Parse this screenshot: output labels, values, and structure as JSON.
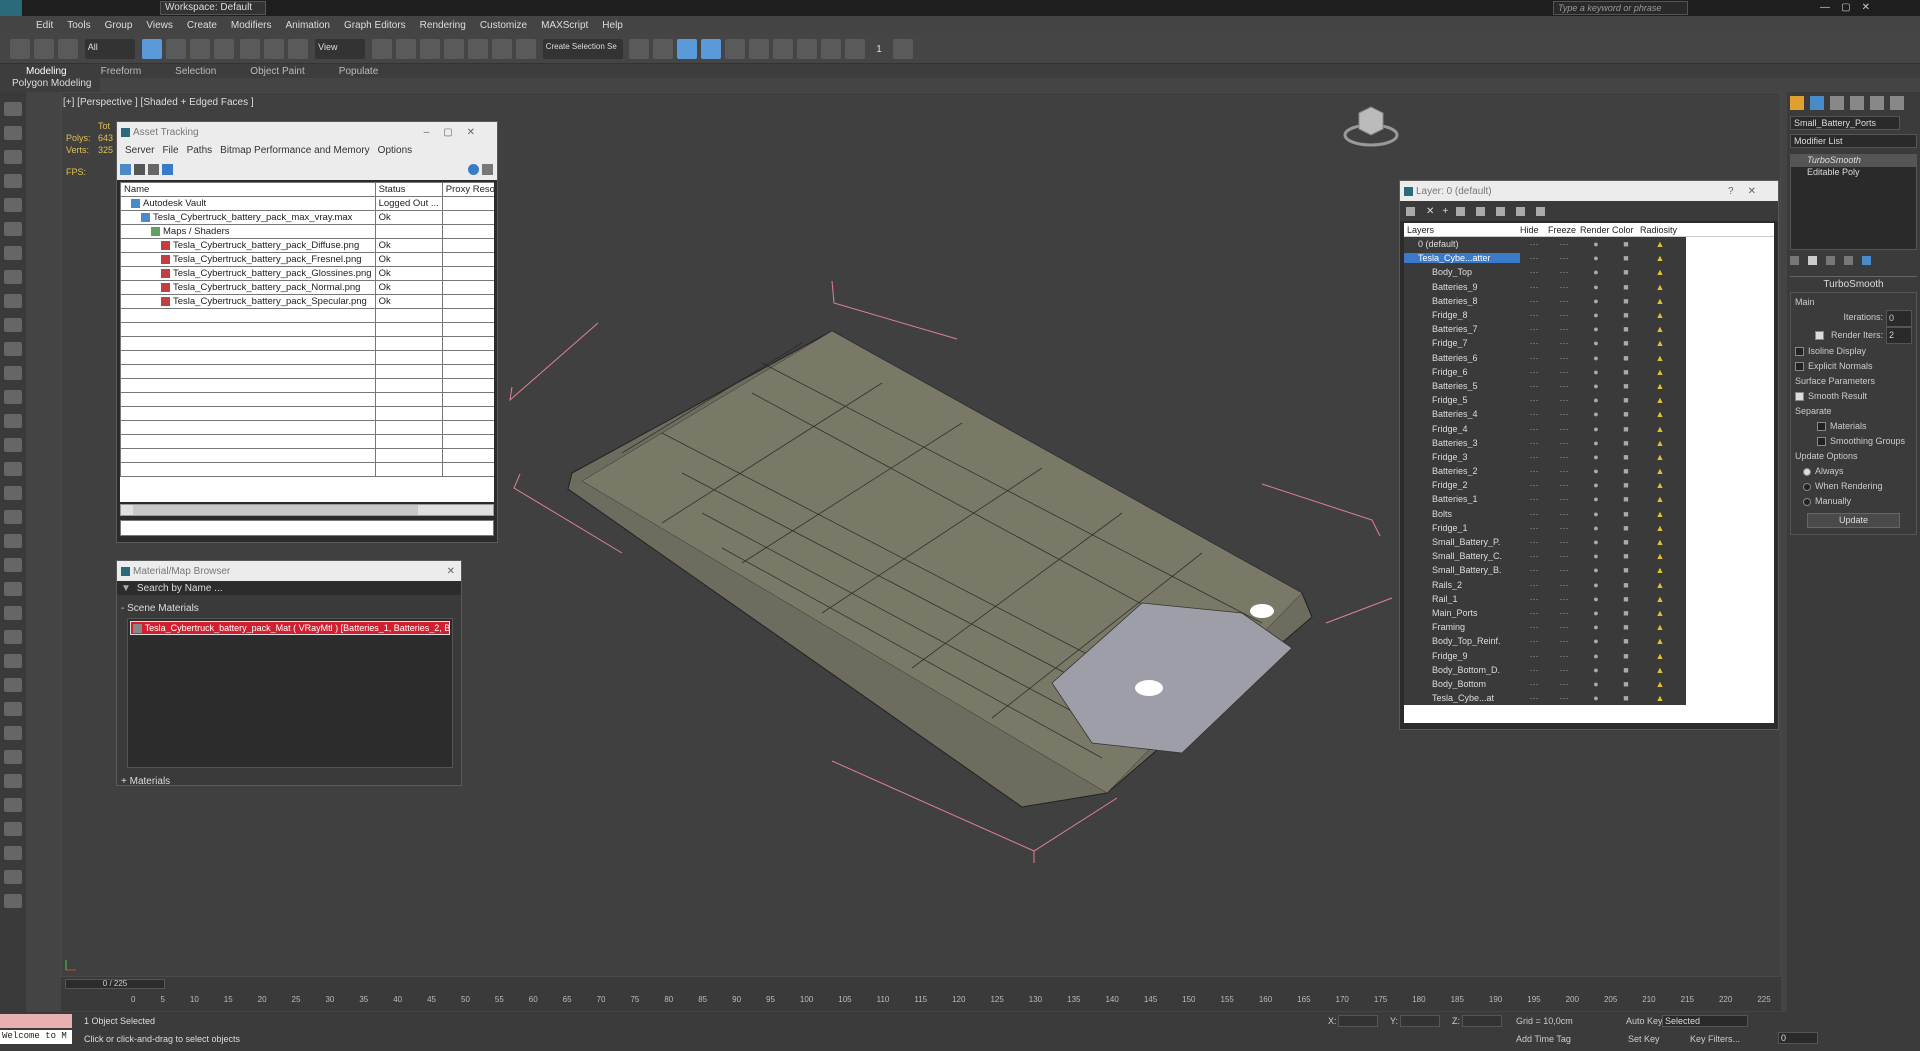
{
  "app": {
    "workspace": "Workspace: Default",
    "search_placeholder": "Type a keyword or phrase"
  },
  "menu": [
    "Edit",
    "Tools",
    "Group",
    "Views",
    "Create",
    "Modifiers",
    "Animation",
    "Graph Editors",
    "Rendering",
    "Customize",
    "MAXScript",
    "Help"
  ],
  "toolbar": {
    "filter": "All",
    "view": "View",
    "selection_set": "Create Selection Se",
    "counter": "1"
  },
  "ribbon": {
    "tabs": [
      "Modeling",
      "Freeform",
      "Selection",
      "Object Paint",
      "Populate"
    ],
    "sub": "Polygon Modeling"
  },
  "viewport": {
    "label": "[+] [Perspective ] [Shaded + Edged Faces ]",
    "stats": {
      "total": "Tot",
      "polys": "Polys:",
      "polys_val": "643",
      "verts": "Verts:",
      "verts_val": "325",
      "fps": "FPS:"
    }
  },
  "asset_tracking": {
    "title": "Asset Tracking",
    "menu": [
      "Server",
      "File",
      "Paths",
      "Bitmap Performance and Memory",
      "Options"
    ],
    "columns": [
      "Name",
      "Status",
      "Proxy Reso"
    ],
    "rows": [
      {
        "name": "Autodesk Vault",
        "status": "Logged Out ...",
        "indent": 1
      },
      {
        "name": "Tesla_Cybertruck_battery_pack_max_vray.max",
        "status": "Ok",
        "indent": 2
      },
      {
        "name": "Maps / Shaders",
        "status": "",
        "indent": 3
      },
      {
        "name": "Tesla_Cybertruck_battery_pack_Diffuse.png",
        "status": "Ok",
        "indent": 4
      },
      {
        "name": "Tesla_Cybertruck_battery_pack_Fresnel.png",
        "status": "Ok",
        "indent": 4
      },
      {
        "name": "Tesla_Cybertruck_battery_pack_Glossines.png",
        "status": "Ok",
        "indent": 4
      },
      {
        "name": "Tesla_Cybertruck_battery_pack_Normal.png",
        "status": "Ok",
        "indent": 4
      },
      {
        "name": "Tesla_Cybertruck_battery_pack_Specular.png",
        "status": "Ok",
        "indent": 4
      }
    ]
  },
  "material_browser": {
    "title": "Material/Map Browser",
    "search_placeholder": "Search by Name ...",
    "section": "- Scene Materials",
    "material": "Tesla_Cybertruck_battery_pack_Mat ( VRayMtl ) [Batteries_1, Batteries_2, Ba...",
    "footer": "+ Materials"
  },
  "layer_explorer": {
    "title": "Layer: 0 (default)",
    "columns": [
      "Layers",
      "Hide",
      "Freeze",
      "Render",
      "Color",
      "Radiosity"
    ],
    "layers": [
      "0 (default)",
      "Tesla_Cybe...atter"
    ],
    "items": [
      "Body_Top",
      "Batteries_9",
      "Batteries_8",
      "Fridge_8",
      "Batteries_7",
      "Fridge_7",
      "Batteries_6",
      "Fridge_6",
      "Batteries_5",
      "Fridge_5",
      "Batteries_4",
      "Fridge_4",
      "Batteries_3",
      "Fridge_3",
      "Batteries_2",
      "Fridge_2",
      "Batteries_1",
      "Bolts",
      "Fridge_1",
      "Small_Battery_P.",
      "Small_Battery_C.",
      "Small_Battery_B.",
      "Rails_2",
      "Rail_1",
      "Main_Ports",
      "Framing",
      "Body_Top_Reinf.",
      "Fridge_9",
      "Body_Bottom_D.",
      "Body_Bottom",
      "Tesla_Cybe...at"
    ]
  },
  "command_panel": {
    "object_name": "Small_Battery_Ports",
    "modifier_list": "Modifier List",
    "stack": [
      "TurboSmooth",
      "Editable Poly"
    ],
    "rollout": "TurboSmooth",
    "main": "Main",
    "iterations_label": "Iterations:",
    "iterations": "0",
    "render_iters_label": "Render Iters:",
    "render_iters": "2",
    "isoline": "Isoline Display",
    "explicit": "Explicit Normals",
    "surface": "Surface Parameters",
    "smooth_result": "Smooth Result",
    "separate": "Separate",
    "materials": "Materials",
    "smoothing_groups": "Smoothing Groups",
    "update_options": "Update Options",
    "always": "Always",
    "when_rendering": "When Rendering",
    "manually": "Manually",
    "update_btn": "Update"
  },
  "timeline": {
    "frame": "0 / 225",
    "ticks": [
      "0",
      "5",
      "10",
      "15",
      "20",
      "25",
      "30",
      "35",
      "40",
      "45",
      "50",
      "55",
      "60",
      "65",
      "70",
      "75",
      "80",
      "85",
      "90",
      "95",
      "100",
      "105",
      "110",
      "115",
      "120",
      "125",
      "130",
      "135",
      "140",
      "145",
      "150",
      "155",
      "160",
      "165",
      "170",
      "175",
      "180",
      "185",
      "190",
      "195",
      "200",
      "205",
      "210",
      "215",
      "220",
      "225"
    ]
  },
  "status": {
    "welcome": "Welcome to M",
    "selected": "1 Object Selected",
    "hint": "Click or click-and-drag to select objects",
    "x": "X:",
    "y": "Y:",
    "z": "Z:",
    "grid": "Grid = 10,0cm",
    "add_time_tag": "Add Time Tag",
    "auto_key": "Auto Key",
    "set_key": "Set Key",
    "selected_dd": "Selected",
    "key_filters": "Key Filters...",
    "frame_val": "0"
  }
}
